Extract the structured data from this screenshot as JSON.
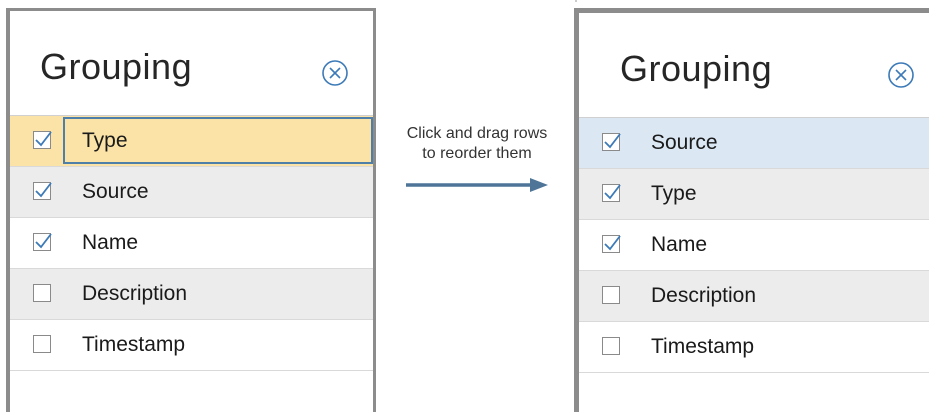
{
  "left_panel": {
    "title": "Grouping",
    "close_icon": "close-circle-icon",
    "dragged_row": {
      "label": "Type",
      "checked": true
    },
    "rows": [
      {
        "label": "Source",
        "checked": true
      },
      {
        "label": "Name",
        "checked": true
      },
      {
        "label": "Description",
        "checked": false
      },
      {
        "label": "Timestamp",
        "checked": false
      }
    ]
  },
  "annotation": {
    "line1": "Click and drag rows",
    "line2": "to reorder them"
  },
  "right_panel": {
    "title": "Grouping",
    "close_icon": "close-circle-icon",
    "rows": [
      {
        "label": "Source",
        "checked": true
      },
      {
        "label": "Type",
        "checked": true
      },
      {
        "label": "Name",
        "checked": true
      },
      {
        "label": "Description",
        "checked": false
      },
      {
        "label": "Timestamp",
        "checked": false
      }
    ]
  },
  "colors": {
    "accent_check": "#3c7ab8",
    "arrow": "#4e7598",
    "selected_row": "#dbe8f4",
    "drag_row": "#fbe3a8",
    "drag_border": "#4e7fa8",
    "shaded_row": "#ececec",
    "panel_border": "#8c8c8c"
  }
}
